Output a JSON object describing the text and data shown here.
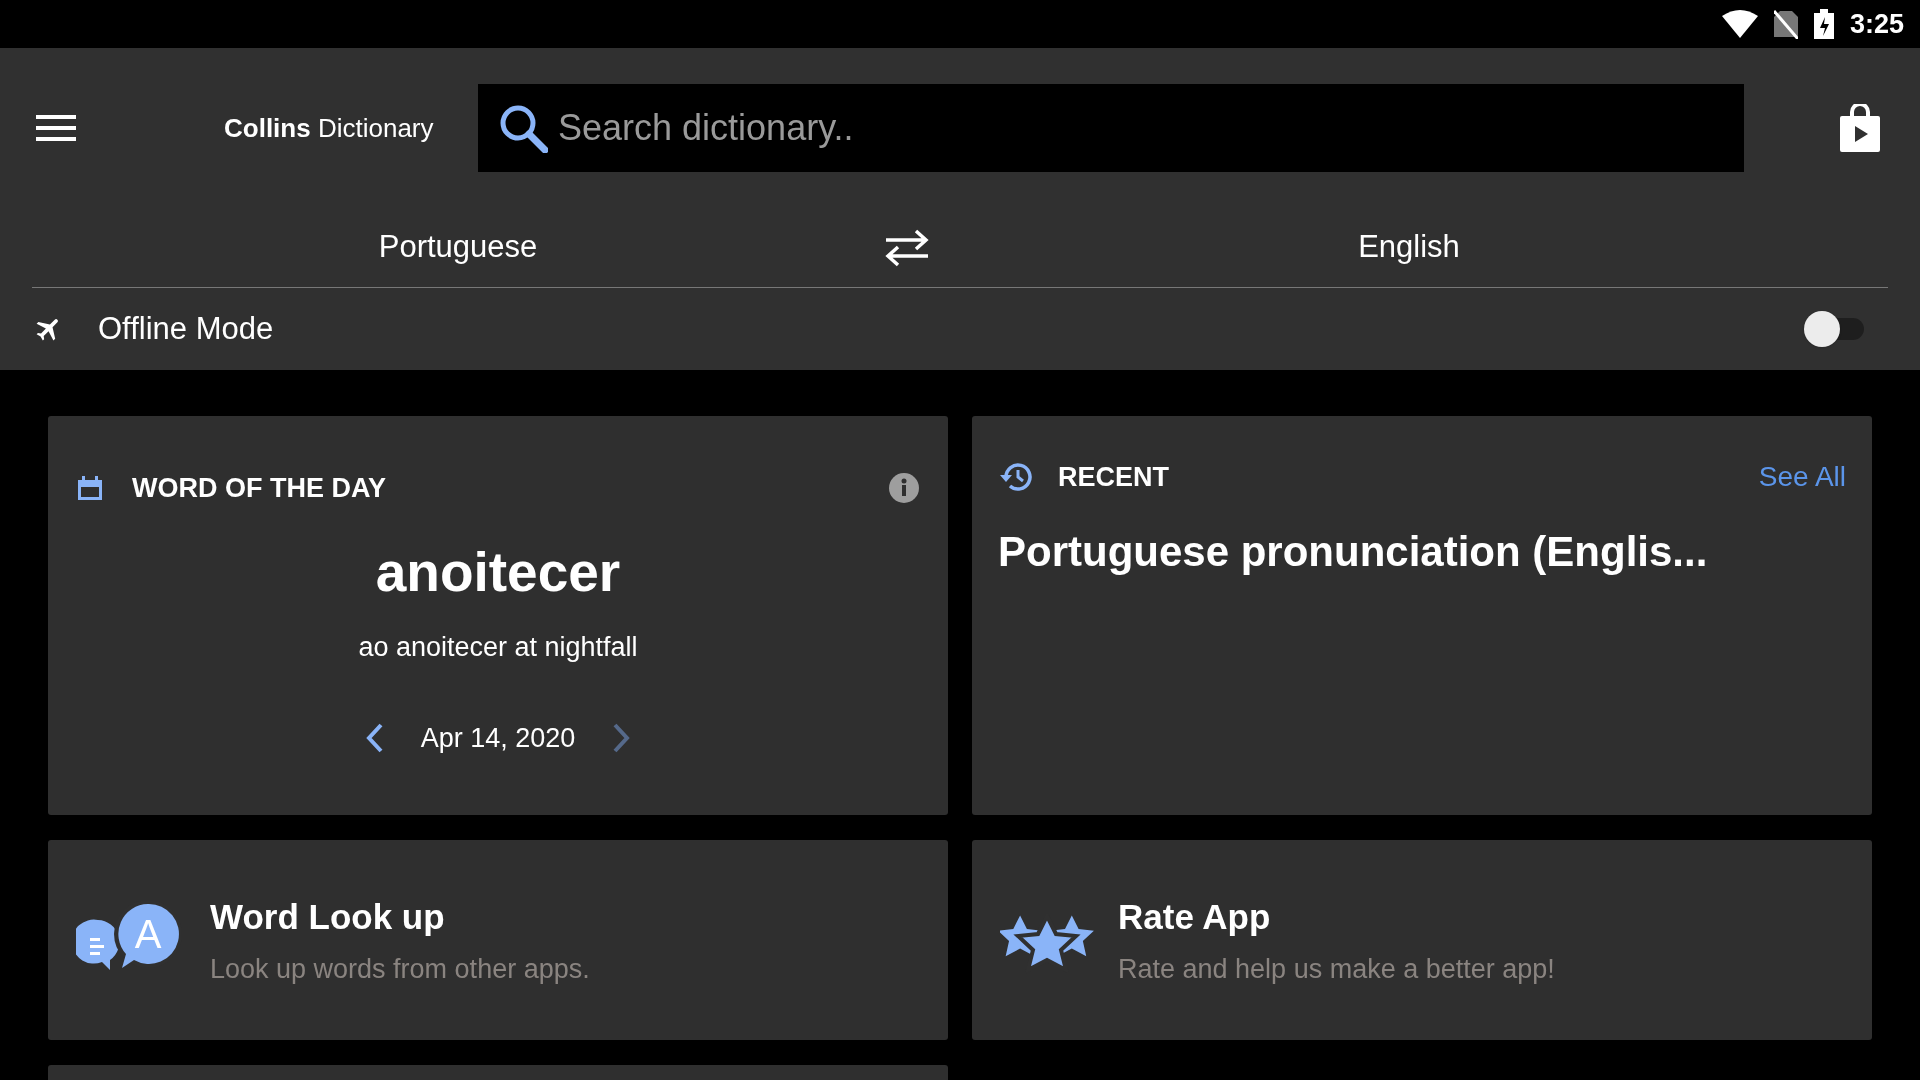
{
  "status_bar": {
    "time": "3:25"
  },
  "app_bar": {
    "title_bold": "Collins",
    "title_rest": "Dictionary",
    "search": {
      "placeholder": "Search dictionary.."
    }
  },
  "languages": {
    "from": "Portuguese",
    "to": "English"
  },
  "offline_mode": {
    "label": "Offline Mode",
    "on": false
  },
  "word_of_the_day": {
    "heading": "WORD OF THE DAY",
    "word": "anoitecer",
    "example": "ao anoitecer at nightfall",
    "date": "Apr 14, 2020"
  },
  "recent": {
    "heading": "RECENT",
    "link": "See All",
    "entry": "Portuguese pronunciation (Englis..."
  },
  "features": [
    {
      "kind": "lookup",
      "icon_letter": "A",
      "title": "Word Look up",
      "subtitle": "Look up words from other apps."
    },
    {
      "kind": "rate",
      "title": "Rate App",
      "subtitle": "Rate and help us make a better app!"
    }
  ]
}
